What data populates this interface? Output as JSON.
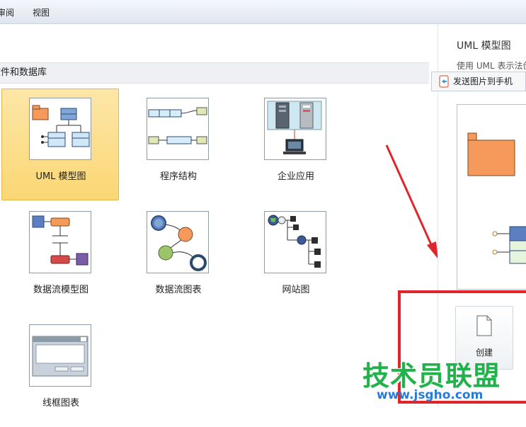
{
  "menubar": {
    "items": [
      {
        "label": "审阅"
      },
      {
        "label": "视图"
      }
    ]
  },
  "section": {
    "header": "文件和数据库"
  },
  "templates": [
    {
      "label": "UML 模型图",
      "selected": true
    },
    {
      "label": "程序结构",
      "selected": false
    },
    {
      "label": "企业应用",
      "selected": false
    },
    {
      "label": "数据流模型图",
      "selected": false
    },
    {
      "label": "数据流图表",
      "selected": false
    },
    {
      "label": "网站图",
      "selected": false
    },
    {
      "label": "线框图表",
      "selected": false
    }
  ],
  "preview": {
    "title": "UML 模型图",
    "description": "使用 UML 表示法创",
    "send_button": "发送图片到手机",
    "create_label": "创建"
  },
  "annotation": {
    "color": "#e0262b"
  },
  "watermark": {
    "text": "技术员联盟",
    "url": "www.jsgho.com"
  }
}
